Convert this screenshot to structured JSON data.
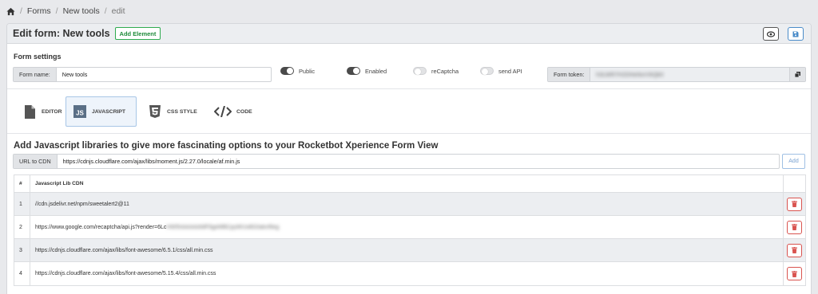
{
  "breadcrumb": {
    "items": [
      "Forms",
      "New tools",
      "edit"
    ]
  },
  "header": {
    "title": "Edit form: New tools",
    "add_element": "Add Element"
  },
  "form_settings": {
    "title": "Form settings",
    "name_label": "Form name:",
    "name_value": "New tools",
    "toggles": [
      {
        "label": "Public",
        "on": true
      },
      {
        "label": "Enabled",
        "on": true
      },
      {
        "label": "reCaptcha",
        "on": false
      },
      {
        "label": "send API",
        "on": false
      }
    ],
    "token_label": "Form token:",
    "token_value": "h3LWR7H2DHeNnrVkQk0"
  },
  "tabs": [
    {
      "label": "EDITOR",
      "icon": "file-icon"
    },
    {
      "label": "JAVASCRIPT",
      "icon": "js-icon",
      "active": true
    },
    {
      "label": "CSS STYLE",
      "icon": "css3-icon"
    },
    {
      "label": "CODE",
      "icon": "code-icon"
    }
  ],
  "js_section": {
    "title": "Add Javascript libraries to give more fascinating options to your Rocketbot Xperience Form View",
    "url_label": "URL to CDN",
    "url_value": "https://cdnjs.cloudflare.com/ajax/libs/moment.js/2.27.0/locale/af.min.js",
    "add_label": "Add"
  },
  "table": {
    "headers": {
      "num": "#",
      "url": "Javascript Lib CDN"
    },
    "rows": [
      {
        "num": "1",
        "url": "//cdn.jsdelivr.net/npm/sweetalert2@11"
      },
      {
        "num": "2",
        "url": "https://www.google.com/recaptcha/api.js?render=6Lc",
        "url_hidden": "HW5hAAAAAMF9geMBCpyWUo8G0akvf9eg"
      },
      {
        "num": "3",
        "url": "https://cdnjs.cloudflare.com/ajax/libs/font-awesome/6.5.1/css/all.min.css"
      },
      {
        "num": "4",
        "url": "https://cdnjs.cloudflare.com/ajax/libs/font-awesome/5.15.4/css/all.min.css"
      }
    ]
  },
  "colors": {
    "danger": "#d9534f",
    "success": "#2eab4f",
    "primary": "#4a8cc9"
  }
}
